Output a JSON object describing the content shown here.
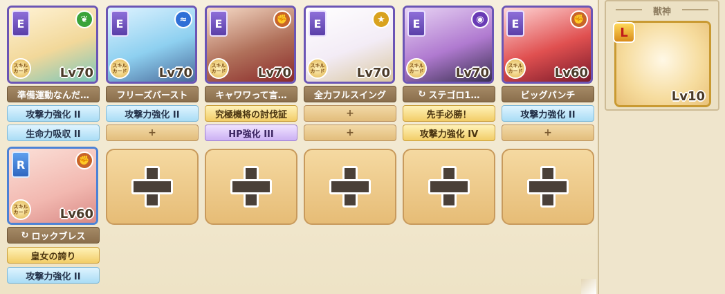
{
  "right_panel": {
    "title": "獣神",
    "pet": {
      "rank": "L",
      "level": "Lv10"
    }
  },
  "units": [
    {
      "rank": "E",
      "element_icon": "leaf-icon",
      "element_color": "#3aa33a",
      "level": "Lv70",
      "skill": "準備運動なんだ…",
      "skill_icon": "",
      "slot1": {
        "text": "攻撃力強化 II",
        "style": "blue"
      },
      "slot2": {
        "text": "生命力吸収 II",
        "style": "blue"
      }
    },
    {
      "rank": "E",
      "element_icon": "water-icon",
      "element_color": "#2f6fd6",
      "level": "Lv70",
      "skill": "フリーズバースト",
      "skill_icon": "",
      "slot1": {
        "text": "攻撃力強化 II",
        "style": "blue"
      },
      "slot2": {
        "text": "+",
        "style": "empty"
      }
    },
    {
      "rank": "E",
      "element_icon": "fist-icon",
      "element_color": "#c8642a",
      "level": "Lv70",
      "skill": "キャワワって言…",
      "skill_icon": "",
      "slot1": {
        "text": "究極機将の討伐証",
        "style": "gold"
      },
      "slot2": {
        "text": "HP強化 III",
        "style": "purple"
      }
    },
    {
      "rank": "E",
      "element_icon": "star-icon",
      "element_color": "#d9a21e",
      "level": "Lv70",
      "skill": "全力フルスイング",
      "skill_icon": "",
      "slot1": {
        "text": "+",
        "style": "empty"
      },
      "slot2": {
        "text": "+",
        "style": "empty"
      }
    },
    {
      "rank": "E",
      "element_icon": "dark-icon",
      "element_color": "#6a3bb5",
      "level": "Lv70",
      "skill": "ステゴロ1…",
      "skill_icon": "↻",
      "slot1": {
        "text": "先手必勝！",
        "style": "gold"
      },
      "slot2": {
        "text": "攻撃力強化 IV",
        "style": "gold"
      }
    },
    {
      "rank": "E",
      "element_icon": "fist-icon",
      "element_color": "#c8642a",
      "level": "Lv60",
      "skill": "ビッグパンチ",
      "skill_icon": "",
      "slot1": {
        "text": "攻撃力強化 II",
        "style": "blue"
      },
      "slot2": {
        "text": "+",
        "style": "empty"
      }
    }
  ],
  "unit7": {
    "rank": "R",
    "element_icon": "fist-icon",
    "element_color": "#c8642a",
    "level": "Lv60",
    "skill": "ロックブレス",
    "skill_icon": "↻",
    "slot1": {
      "text": "皇女の誇り",
      "style": "gold"
    },
    "slot2": {
      "text": "攻撃力強化 II",
      "style": "blue"
    }
  },
  "skill_badge_label": "スキルカード",
  "empty_slots": 5
}
